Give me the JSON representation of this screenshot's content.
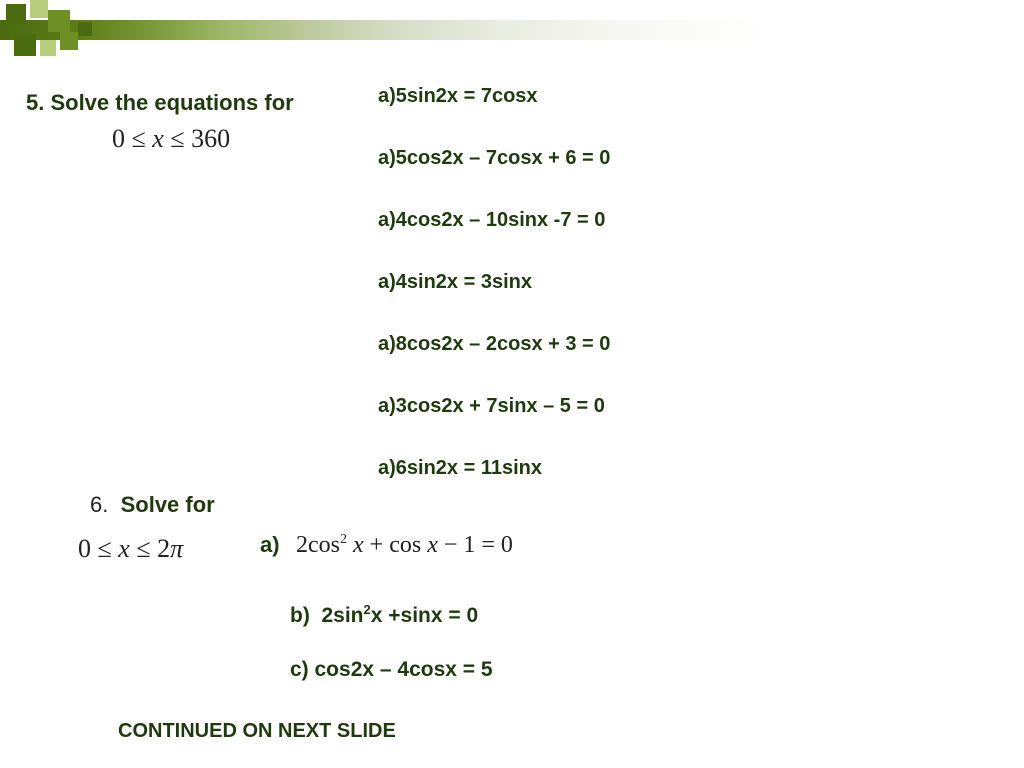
{
  "q5": {
    "title": "5.  Solve the equations for",
    "range": "0 ≤ x ≤ 360",
    "items": [
      "a)5sin2x = 7cosx",
      "a)5cos2x – 7cosx + 6 = 0",
      "a)4cos2x – 10sinx -7 = 0",
      "a)4sin2x = 3sinx",
      "a)8cos2x – 2cosx + 3 = 0",
      "a)3cos2x + 7sinx – 5 = 0",
      "a)6sin2x = 11sinx"
    ]
  },
  "q6": {
    "num": "6.",
    "title": "Solve for",
    "range": "0 ≤ x ≤ 2π",
    "a_label": "a)",
    "a_eq_html": "2cos<sup>2</sup> <i>x</i> + cos <i>x</i> − 1 = 0",
    "b_html": "b)&nbsp;&nbsp;2sin<sup>2</sup>x +sinx = 0",
    "c": "c)  cos2x – 4cosx = 5"
  },
  "footer": "CONTINUED ON NEXT SLIDE"
}
